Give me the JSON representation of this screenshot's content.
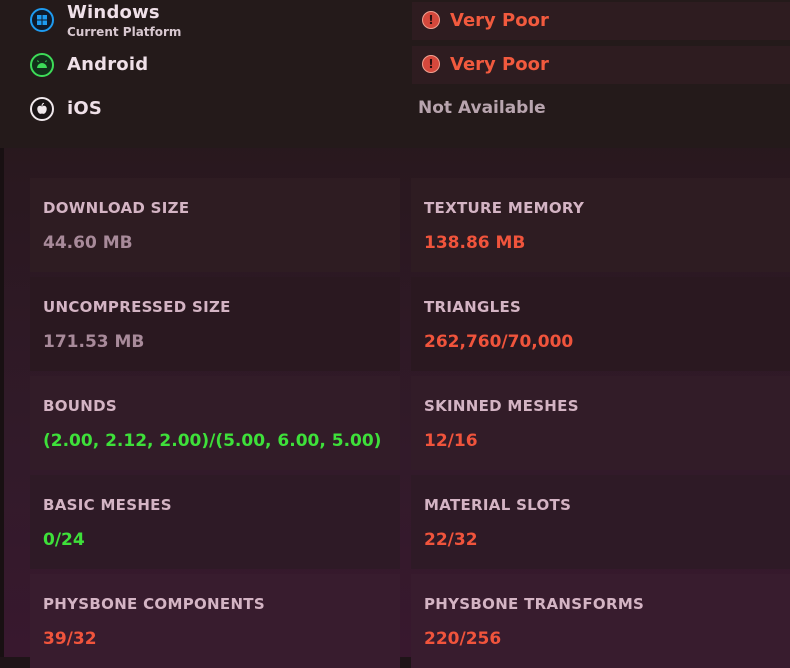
{
  "platforms": [
    {
      "name": "Windows",
      "subtitle": "Current Platform",
      "rating": "Very Poor",
      "icon": "windows-icon"
    },
    {
      "name": "Android",
      "subtitle": "",
      "rating": "Very Poor",
      "icon": "android-icon"
    },
    {
      "name": "iOS",
      "subtitle": "",
      "rating": "Not Available",
      "icon": "apple-icon"
    }
  ],
  "stats": {
    "download_size": {
      "label": "DOWNLOAD SIZE",
      "value": "44.60 MB"
    },
    "texture_memory": {
      "label": "TEXTURE MEMORY",
      "value": "138.86 MB"
    },
    "uncompressed_size": {
      "label": "UNCOMPRESSED SIZE",
      "value": "171.53 MB"
    },
    "triangles": {
      "label": "TRIANGLES",
      "value": "262,760/70,000"
    },
    "bounds": {
      "label": "BOUNDS",
      "value": "(2.00, 2.12, 2.00)/(5.00, 6.00, 5.00)"
    },
    "skinned_meshes": {
      "label": "SKINNED MESHES",
      "value": "12/16"
    },
    "basic_meshes": {
      "label": "BASIC MESHES",
      "value": "0/24"
    },
    "material_slots": {
      "label": "MATERIAL SLOTS",
      "value": "22/32"
    },
    "physbone_components": {
      "label": "PHYSBONE COMPONENTS",
      "value": "39/32"
    },
    "physbone_transforms": {
      "label": "PHYSBONE TRANSFORMS",
      "value": "220/256"
    }
  },
  "colors": {
    "bad": "#f0543c",
    "good": "#3ee03a",
    "neutral": "#a88a9a",
    "windows_blue": "#1e9bf0",
    "android_green": "#3ddc58"
  }
}
